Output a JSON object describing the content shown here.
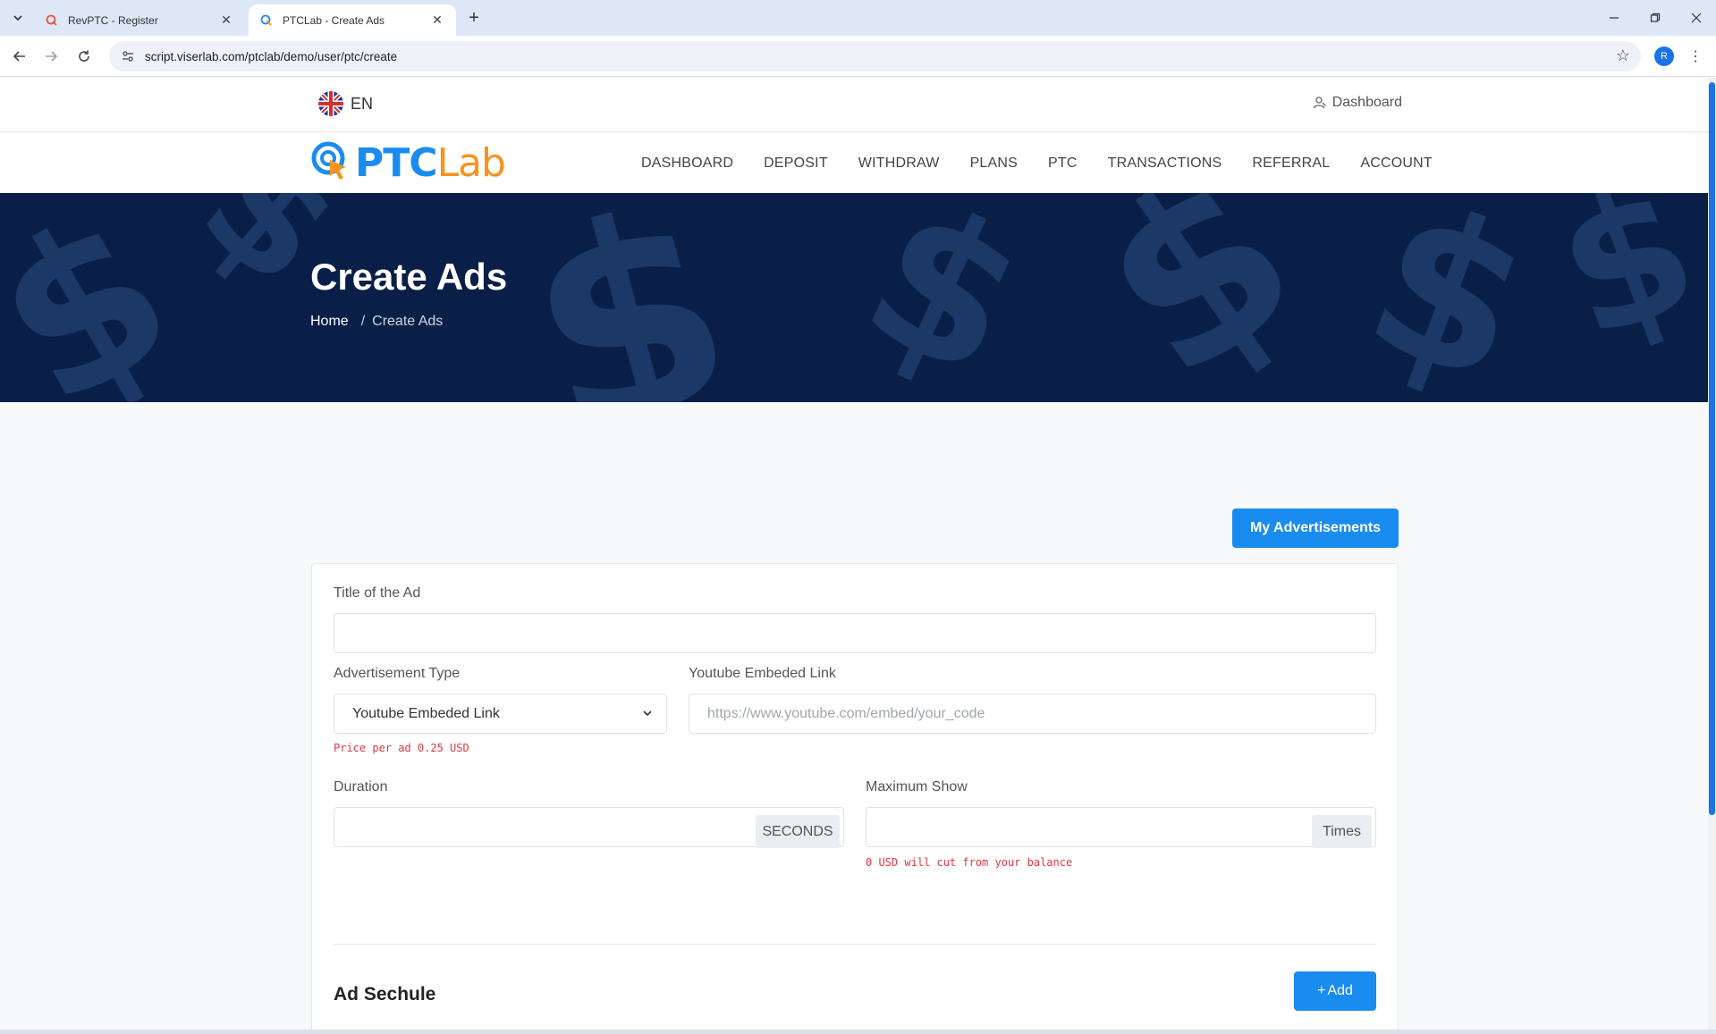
{
  "browser": {
    "tabs": [
      {
        "title": "RevPTC - Register",
        "active": false
      },
      {
        "title": "PTCLab - Create Ads",
        "active": true
      }
    ],
    "url": "script.viserlab.com/ptclab/demo/user/ptc/create",
    "profile_initial": "R"
  },
  "topbar": {
    "language": "EN",
    "dashboard_link": "Dashboard"
  },
  "logo": {
    "part1": "PTC",
    "part2": "Lab",
    "colors": {
      "ptc": "#1a8cf0",
      "lab": "#f7931e"
    }
  },
  "nav": {
    "items": [
      "DASHBOARD",
      "DEPOSIT",
      "WITHDRAW",
      "PLANS",
      "PTC",
      "TRANSACTIONS",
      "REFERRAL",
      "ACCOUNT"
    ]
  },
  "hero": {
    "title": "Create Ads",
    "breadcrumb": {
      "home": "Home",
      "separator": "/",
      "current": "Create Ads"
    }
  },
  "actions": {
    "my_ads": "My Advertisements"
  },
  "form": {
    "title_label": "Title of the Ad",
    "title_value": "",
    "type_label": "Advertisement Type",
    "type_value": "Youtube Embeded Link",
    "type_hint": "Price per ad 0.25 USD",
    "link_label": "Youtube Embeded Link",
    "link_placeholder": "https://www.youtube.com/embed/your_code",
    "duration_label": "Duration",
    "duration_addon": "SECONDS",
    "max_label": "Maximum Show",
    "max_addon": "Times",
    "max_hint": "0 USD will cut from your balance"
  },
  "schedule": {
    "title": "Ad Sechule",
    "add_label": "Add",
    "add_icon": "+"
  },
  "colors": {
    "primary": "#1a8cf0",
    "hero_bg": "#0a1f47",
    "error": "#e0383e"
  }
}
